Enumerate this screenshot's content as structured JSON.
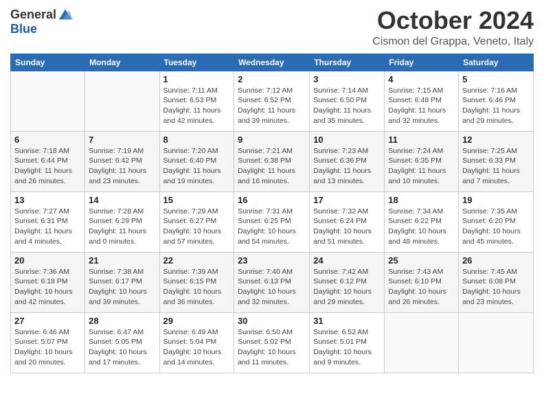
{
  "header": {
    "logo_general": "General",
    "logo_blue": "Blue",
    "month": "October 2024",
    "location": "Cismon del Grappa, Veneto, Italy"
  },
  "days_of_week": [
    "Sunday",
    "Monday",
    "Tuesday",
    "Wednesday",
    "Thursday",
    "Friday",
    "Saturday"
  ],
  "weeks": [
    [
      {
        "day": "",
        "detail": ""
      },
      {
        "day": "",
        "detail": ""
      },
      {
        "day": "1",
        "detail": "Sunrise: 7:11 AM\nSunset: 6:53 PM\nDaylight: 11 hours and 42 minutes."
      },
      {
        "day": "2",
        "detail": "Sunrise: 7:12 AM\nSunset: 6:52 PM\nDaylight: 11 hours and 39 minutes."
      },
      {
        "day": "3",
        "detail": "Sunrise: 7:14 AM\nSunset: 6:50 PM\nDaylight: 11 hours and 35 minutes."
      },
      {
        "day": "4",
        "detail": "Sunrise: 7:15 AM\nSunset: 6:48 PM\nDaylight: 11 hours and 32 minutes."
      },
      {
        "day": "5",
        "detail": "Sunrise: 7:16 AM\nSunset: 6:46 PM\nDaylight: 11 hours and 29 minutes."
      }
    ],
    [
      {
        "day": "6",
        "detail": "Sunrise: 7:18 AM\nSunset: 6:44 PM\nDaylight: 11 hours and 26 minutes."
      },
      {
        "day": "7",
        "detail": "Sunrise: 7:19 AM\nSunset: 6:42 PM\nDaylight: 11 hours and 23 minutes."
      },
      {
        "day": "8",
        "detail": "Sunrise: 7:20 AM\nSunset: 6:40 PM\nDaylight: 11 hours and 19 minutes."
      },
      {
        "day": "9",
        "detail": "Sunrise: 7:21 AM\nSunset: 6:38 PM\nDaylight: 11 hours and 16 minutes."
      },
      {
        "day": "10",
        "detail": "Sunrise: 7:23 AM\nSunset: 6:36 PM\nDaylight: 11 hours and 13 minutes."
      },
      {
        "day": "11",
        "detail": "Sunrise: 7:24 AM\nSunset: 6:35 PM\nDaylight: 11 hours and 10 minutes."
      },
      {
        "day": "12",
        "detail": "Sunrise: 7:25 AM\nSunset: 6:33 PM\nDaylight: 11 hours and 7 minutes."
      }
    ],
    [
      {
        "day": "13",
        "detail": "Sunrise: 7:27 AM\nSunset: 6:31 PM\nDaylight: 11 hours and 4 minutes."
      },
      {
        "day": "14",
        "detail": "Sunrise: 7:28 AM\nSunset: 6:29 PM\nDaylight: 11 hours and 0 minutes."
      },
      {
        "day": "15",
        "detail": "Sunrise: 7:29 AM\nSunset: 6:27 PM\nDaylight: 10 hours and 57 minutes."
      },
      {
        "day": "16",
        "detail": "Sunrise: 7:31 AM\nSunset: 6:25 PM\nDaylight: 10 hours and 54 minutes."
      },
      {
        "day": "17",
        "detail": "Sunrise: 7:32 AM\nSunset: 6:24 PM\nDaylight: 10 hours and 51 minutes."
      },
      {
        "day": "18",
        "detail": "Sunrise: 7:34 AM\nSunset: 6:22 PM\nDaylight: 10 hours and 48 minutes."
      },
      {
        "day": "19",
        "detail": "Sunrise: 7:35 AM\nSunset: 6:20 PM\nDaylight: 10 hours and 45 minutes."
      }
    ],
    [
      {
        "day": "20",
        "detail": "Sunrise: 7:36 AM\nSunset: 6:18 PM\nDaylight: 10 hours and 42 minutes."
      },
      {
        "day": "21",
        "detail": "Sunrise: 7:38 AM\nSunset: 6:17 PM\nDaylight: 10 hours and 39 minutes."
      },
      {
        "day": "22",
        "detail": "Sunrise: 7:39 AM\nSunset: 6:15 PM\nDaylight: 10 hours and 36 minutes."
      },
      {
        "day": "23",
        "detail": "Sunrise: 7:40 AM\nSunset: 6:13 PM\nDaylight: 10 hours and 32 minutes."
      },
      {
        "day": "24",
        "detail": "Sunrise: 7:42 AM\nSunset: 6:12 PM\nDaylight: 10 hours and 29 minutes."
      },
      {
        "day": "25",
        "detail": "Sunrise: 7:43 AM\nSunset: 6:10 PM\nDaylight: 10 hours and 26 minutes."
      },
      {
        "day": "26",
        "detail": "Sunrise: 7:45 AM\nSunset: 6:08 PM\nDaylight: 10 hours and 23 minutes."
      }
    ],
    [
      {
        "day": "27",
        "detail": "Sunrise: 6:46 AM\nSunset: 5:07 PM\nDaylight: 10 hours and 20 minutes."
      },
      {
        "day": "28",
        "detail": "Sunrise: 6:47 AM\nSunset: 5:05 PM\nDaylight: 10 hours and 17 minutes."
      },
      {
        "day": "29",
        "detail": "Sunrise: 6:49 AM\nSunset: 5:04 PM\nDaylight: 10 hours and 14 minutes."
      },
      {
        "day": "30",
        "detail": "Sunrise: 6:50 AM\nSunset: 5:02 PM\nDaylight: 10 hours and 11 minutes."
      },
      {
        "day": "31",
        "detail": "Sunrise: 6:52 AM\nSunset: 5:01 PM\nDaylight: 10 hours and 9 minutes."
      },
      {
        "day": "",
        "detail": ""
      },
      {
        "day": "",
        "detail": ""
      }
    ]
  ]
}
